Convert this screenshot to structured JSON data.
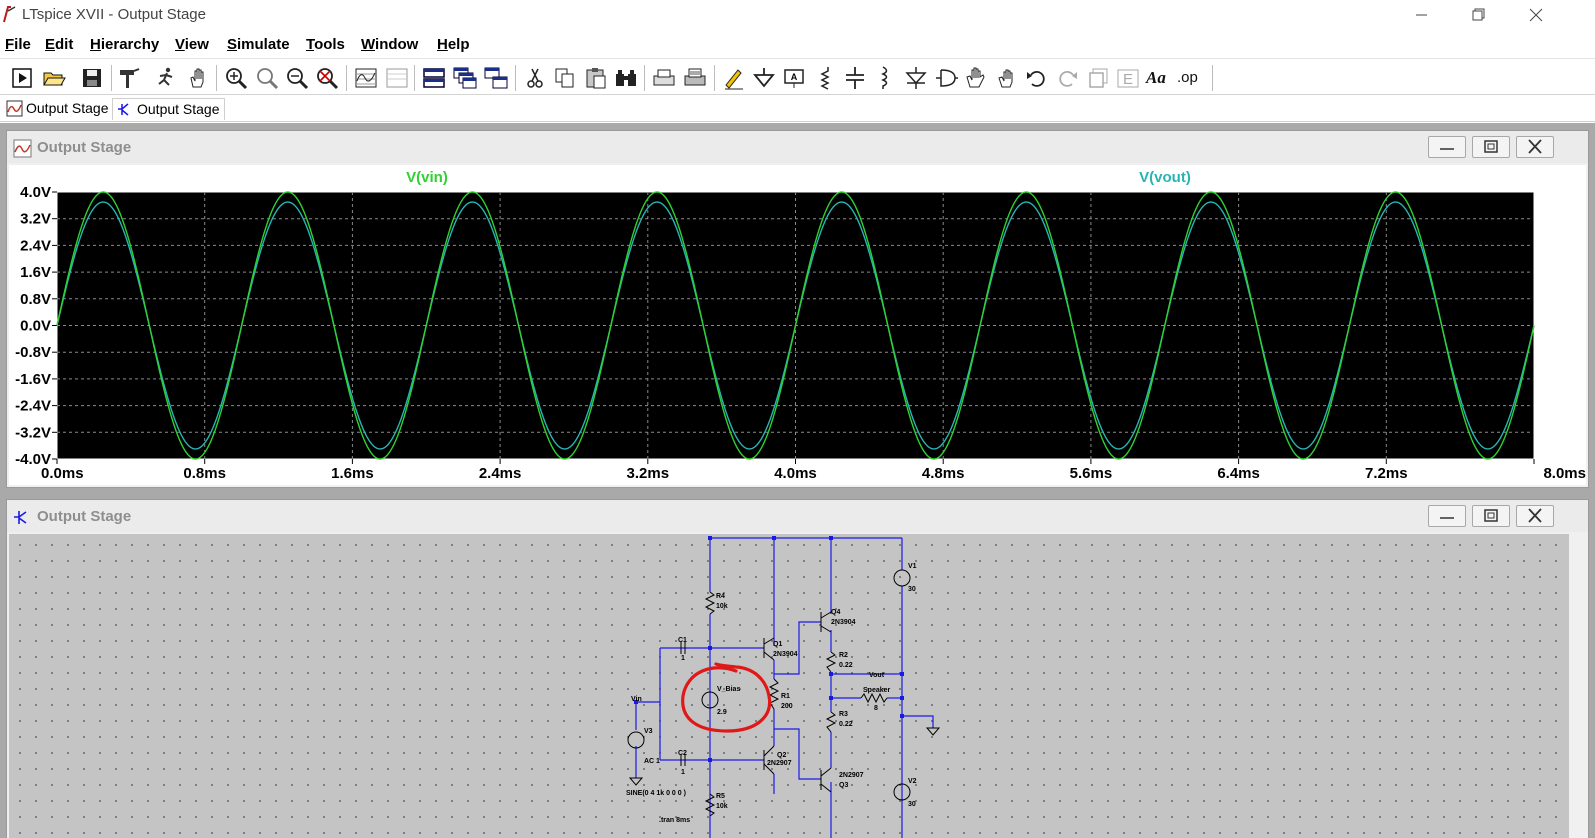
{
  "window": {
    "title": "LTspice XVII - Output Stage",
    "minimize_glyph": "—",
    "restore_glyph": "❐",
    "close_glyph": "✕"
  },
  "menu": [
    {
      "label": "File",
      "u": "F",
      "rest": "ile"
    },
    {
      "label": "Edit",
      "u": "E",
      "rest": "dit"
    },
    {
      "label": "Hierarchy",
      "u": "H",
      "rest": "ierarchy"
    },
    {
      "label": "View",
      "u": "V",
      "rest": "iew"
    },
    {
      "label": "Simulate",
      "u": "S",
      "rest": "imulate"
    },
    {
      "label": "Tools",
      "u": "T",
      "rest": "ools"
    },
    {
      "label": "Window",
      "u": "W",
      "rest": "indow"
    },
    {
      "label": "Help",
      "u": "H",
      "rest": "elp"
    }
  ],
  "toolbar": {
    "text_tool": "Aa",
    "spice_directive": ".op"
  },
  "tabs": [
    {
      "label": "Output Stage",
      "kind": "waveform",
      "active": false
    },
    {
      "label": "Output Stage",
      "kind": "schematic",
      "active": true
    }
  ],
  "plot_window": {
    "title": "Output Stage"
  },
  "schematic_window": {
    "title": "Output Stage"
  },
  "chart_data": {
    "type": "line",
    "x_unit": "ms",
    "y_unit": "V",
    "xlim": [
      0.0,
      8.0
    ],
    "ylim": [
      -4.0,
      4.0
    ],
    "x_ticks": [
      "0.0ms",
      "0.8ms",
      "1.6ms",
      "2.4ms",
      "3.2ms",
      "4.0ms",
      "4.8ms",
      "5.6ms",
      "6.4ms",
      "7.2ms",
      "8.0ms"
    ],
    "y_ticks": [
      "4.0V",
      "3.2V",
      "2.4V",
      "1.6V",
      "0.8V",
      "0.0V",
      "-0.8V",
      "-1.6V",
      "-2.4V",
      "-3.2V",
      "-4.0V"
    ],
    "grid": true,
    "background": "#000000",
    "series": [
      {
        "name": "V(vin)",
        "color": "#2fd12f",
        "waveform": "sine",
        "amplitude": 4.0,
        "offset": 0.0,
        "frequency_khz": 1.0,
        "phase_deg": 0
      },
      {
        "name": "V(vout)",
        "color": "#28b4b4",
        "waveform": "sine",
        "amplitude": 3.7,
        "offset": 0.0,
        "frequency_khz": 1.0,
        "phase_deg": 0
      }
    ]
  },
  "schematic": {
    "labels": {
      "v1": "V1",
      "v1_val": "30",
      "v2": "V2",
      "v2_val": "30",
      "v3": "V3",
      "v3_ac": "AC 1",
      "v3_sine": "SINE(0 4 1k 0 0 0 )",
      "vbias": "V_Bias",
      "vbias_val": "2.9",
      "r1": "R1",
      "r1_val": "200",
      "r2": "R2",
      "r2_val": "0.22",
      "r3": "R3",
      "r3_val": "0.22",
      "r4": "R4",
      "r4_val": "10k",
      "r5": "R5",
      "r5_val": "10k",
      "c1": "C1",
      "c1_val": "1",
      "c2": "C2",
      "c2_val": "1",
      "q1": "Q1",
      "q1_model": "2N3904",
      "q2": "Q2",
      "q2_model": "2N2907",
      "q3": "Q3",
      "q3_model": "2N2907",
      "q4": "Q4",
      "q4_model": "2N3904",
      "speaker": "Speaker",
      "speaker_val": "8",
      "vout_net": "Vout",
      "vin_net": "Vin",
      "tran": ".tran 8ms"
    },
    "wire_color": "#1a1ae6",
    "annotation_color": "#e01818"
  }
}
